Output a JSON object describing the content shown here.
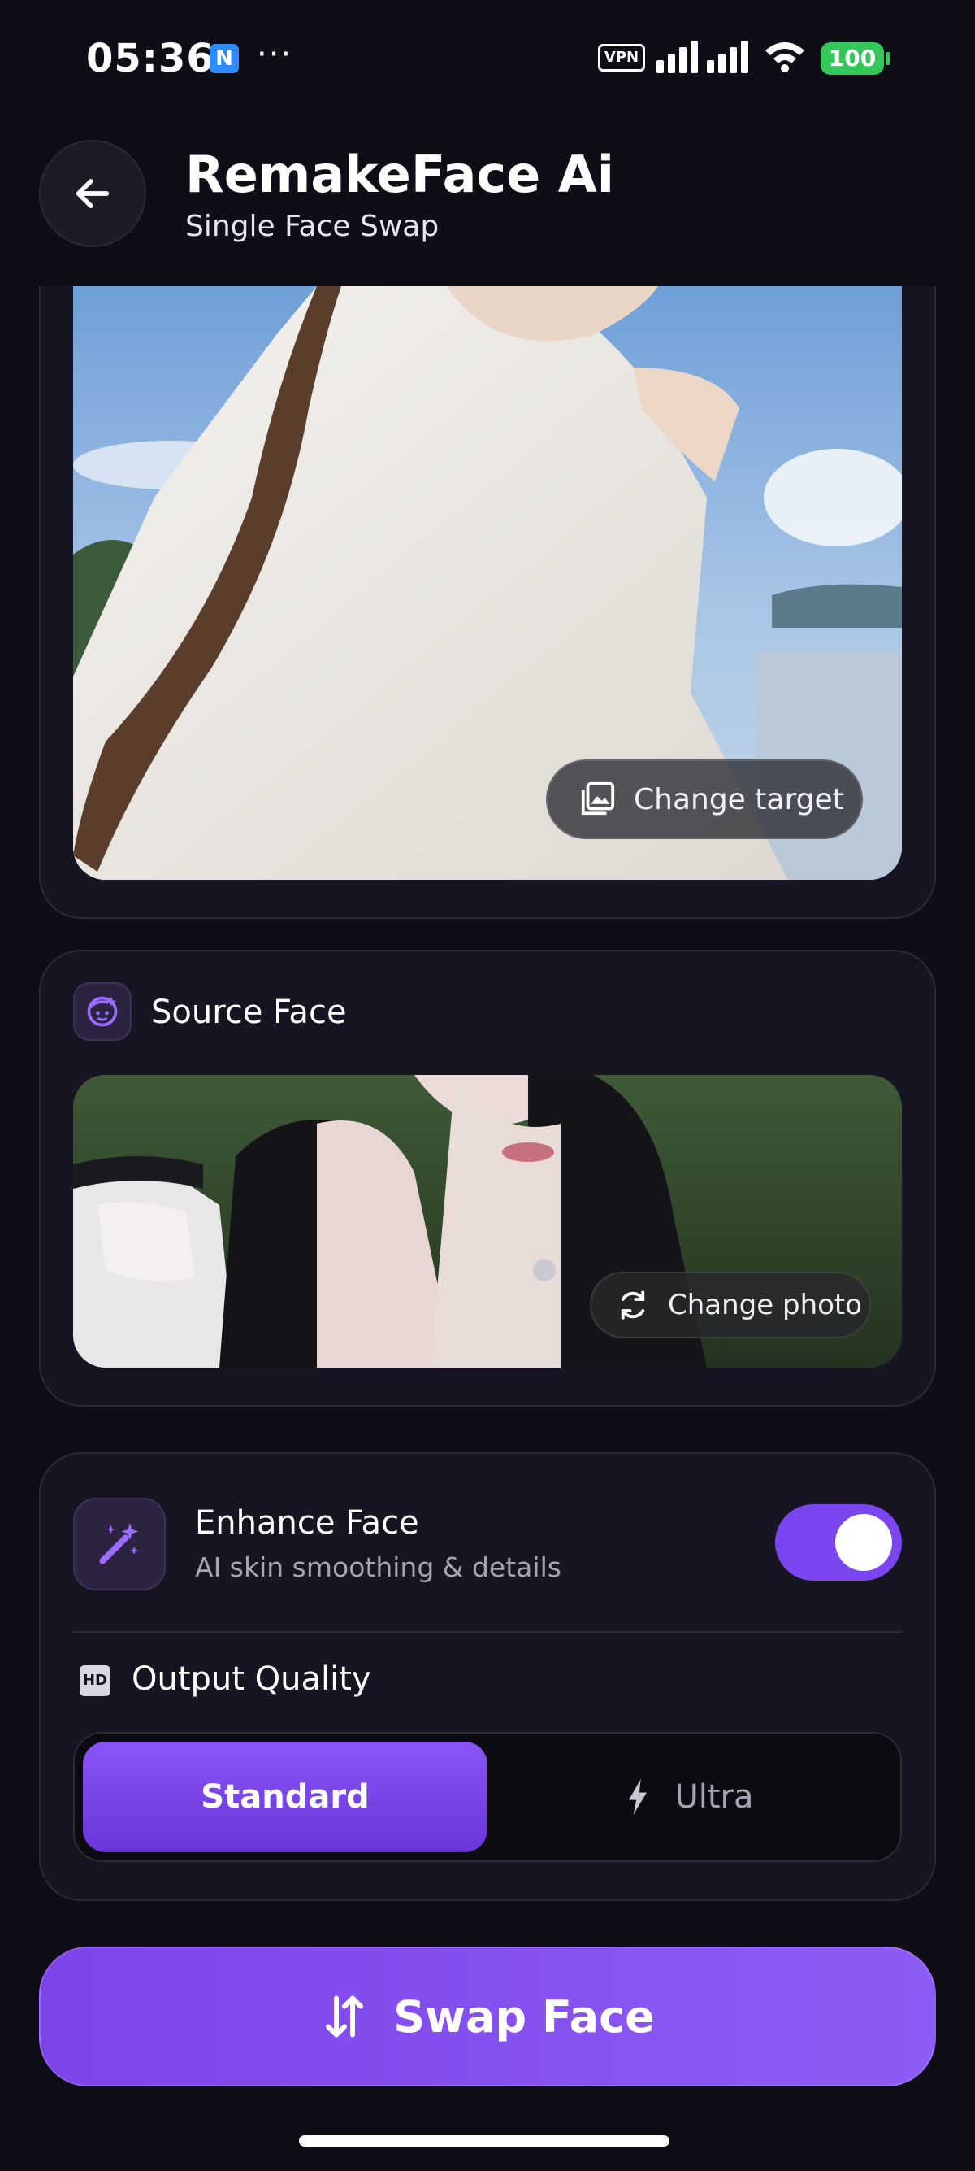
{
  "status_bar": {
    "time": "05:36",
    "app_badge": "N",
    "more": "···",
    "vpn": "VPN",
    "battery": "100"
  },
  "header": {
    "title": "RemakeFace Ai",
    "subtitle": "Single Face Swap"
  },
  "target": {
    "change_label": "Change target"
  },
  "source": {
    "title": "Source Face",
    "change_label": "Change photo"
  },
  "enhance": {
    "title": "Enhance Face",
    "subtitle": "AI skin smoothing & details",
    "enabled": true
  },
  "quality": {
    "title": "Output Quality",
    "hd_badge": "HD",
    "options": [
      "Standard",
      "Ultra"
    ],
    "selected": "Standard"
  },
  "action": {
    "label": "Swap Face"
  },
  "colors": {
    "accent": "#7b46ef",
    "background": "#0f0e17",
    "card": "#161521"
  }
}
